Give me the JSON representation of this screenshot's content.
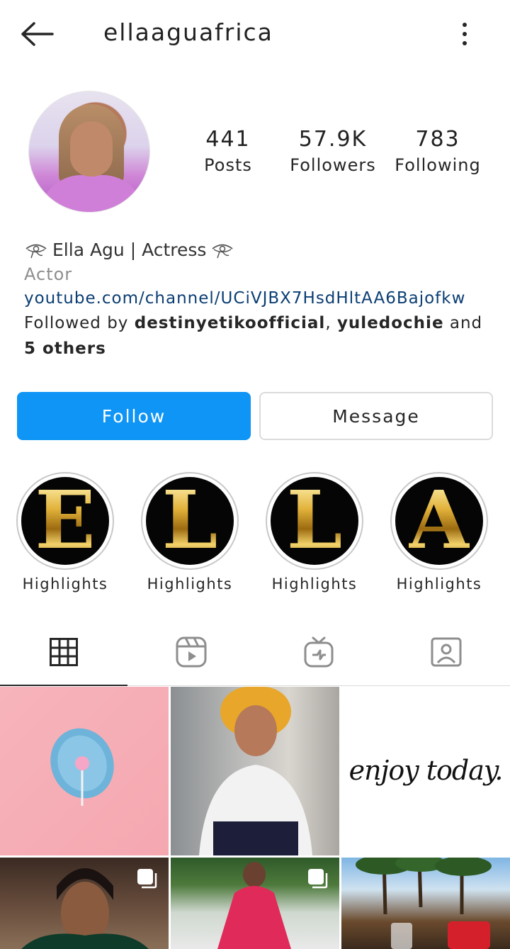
{
  "header": {
    "username": "ellaaguafrica",
    "back_icon": "arrow-left-icon",
    "more_icon": "more-vertical-icon"
  },
  "profile": {
    "stats": [
      {
        "value": "441",
        "label": "Posts"
      },
      {
        "value": "57.9K",
        "label": "Followers"
      },
      {
        "value": "783",
        "label": "Following"
      }
    ]
  },
  "bio": {
    "name": "Ella Agu | Actress",
    "category": "Actor",
    "link": "youtube.com/channel/UCiVJBX7HsdHltAA6Bajofkw",
    "followed_prefix": "Followed by ",
    "followed_user1": "destinyetikoofficial",
    "followed_sep": ", ",
    "followed_user2": "yuledochie",
    "followed_and": " and ",
    "followed_others": "5 others"
  },
  "actions": {
    "follow_label": "Follow",
    "message_label": "Message",
    "follow_color": "#0f95f5"
  },
  "highlights": [
    {
      "letter": "E",
      "label": "Highlights"
    },
    {
      "letter": "L",
      "label": "Highlights"
    },
    {
      "letter": "L",
      "label": "Highlights"
    },
    {
      "letter": "A",
      "label": "Highlights"
    }
  ],
  "tabs": [
    {
      "icon": "grid-icon",
      "active": true
    },
    {
      "icon": "reels-icon",
      "active": false
    },
    {
      "icon": "igtv-icon",
      "active": false
    },
    {
      "icon": "tagged-icon",
      "active": false
    }
  ],
  "grid": {
    "tile3_text": "enjoy today."
  }
}
